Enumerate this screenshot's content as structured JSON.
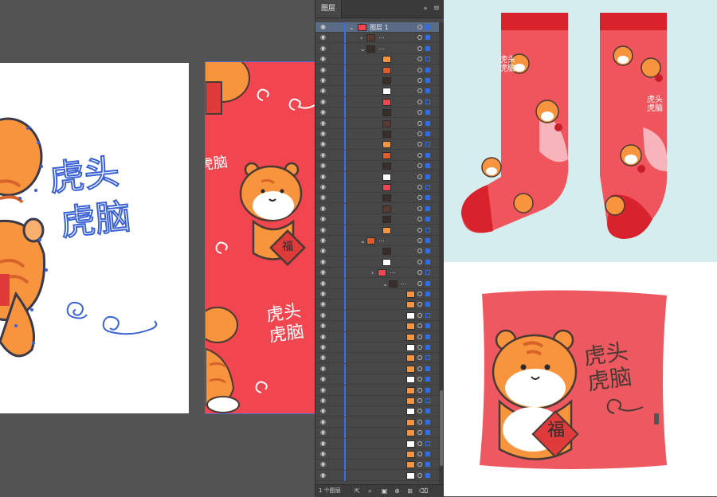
{
  "layers_panel": {
    "tab_label": "图层",
    "top_layer_name": "图层 1",
    "footer_text": "1 个图层",
    "collapse_icon": "»",
    "menu_icon": "≡"
  },
  "artwork": {
    "slogan_line1": "虎头",
    "slogan_line2": "虎脑",
    "badge_text": "福"
  },
  "colors": {
    "bg_dark": "#535353",
    "panel_bg": "#474747",
    "selection_blue": "#2f6ee8",
    "pattern_red": "#f1464f",
    "tiger_orange": "#f7943d",
    "outline_blue": "#3a62d6",
    "mint_bg": "#d6edef"
  }
}
